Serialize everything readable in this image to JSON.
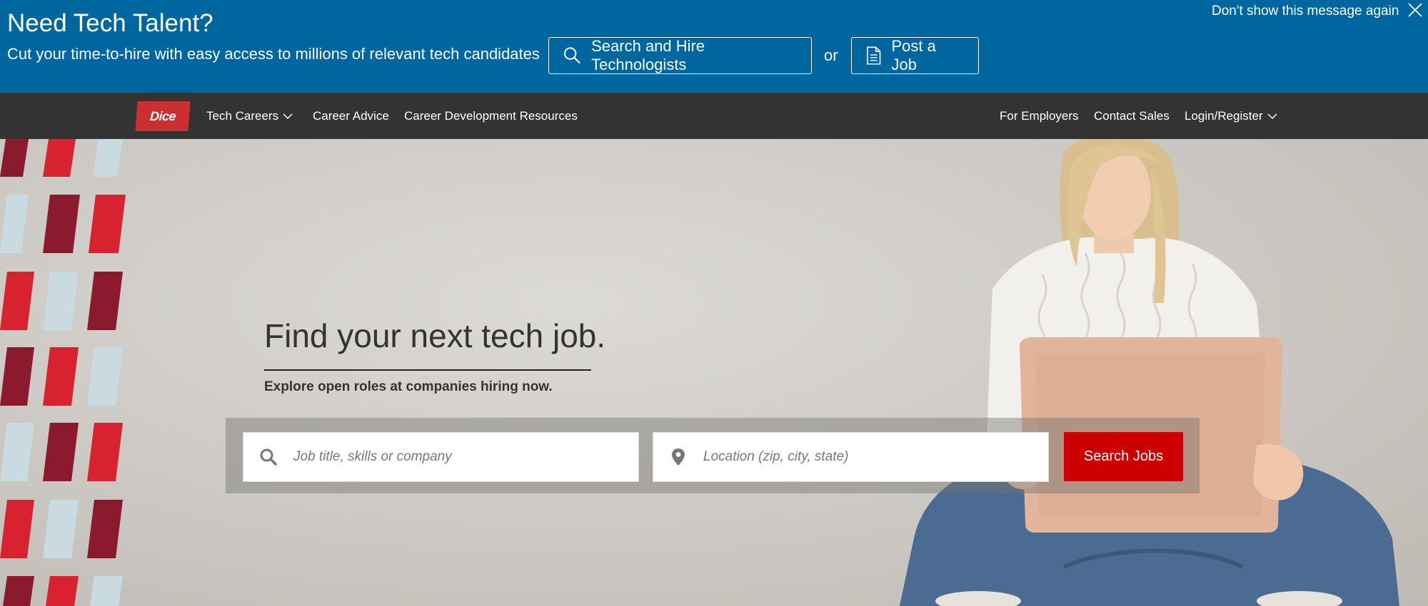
{
  "promo": {
    "title": "Need Tech Talent?",
    "subtitle": "Cut your time-to-hire with easy access to millions of relevant tech candidates",
    "hire_button": "Search and Hire Technologists",
    "or_text": "or",
    "post_button": "Post a Job",
    "dismiss": "Don't show this message again",
    "background_color": "#00669f"
  },
  "nav": {
    "logo_text": "Dice",
    "items_left": [
      "Tech Careers",
      "Career Advice",
      "Career Development Resources"
    ],
    "items_right": [
      "For Employers",
      "Contact Sales",
      "Login/Register"
    ],
    "background_color": "#333333"
  },
  "hero": {
    "title": "Find your next tech job.",
    "subtitle": "Explore open roles at companies hiring now.",
    "job_placeholder": "Job title, skills or company",
    "location_placeholder": "Location (zip, city, state)",
    "search_button": "Search Jobs",
    "accent_color": "#cc0000"
  },
  "icons": {
    "hire": "search-icon",
    "post": "document-icon",
    "dismiss": "close-icon",
    "dropdown": "chevron-down-icon",
    "job_field": "search-icon",
    "location_field": "map-pin-icon"
  }
}
